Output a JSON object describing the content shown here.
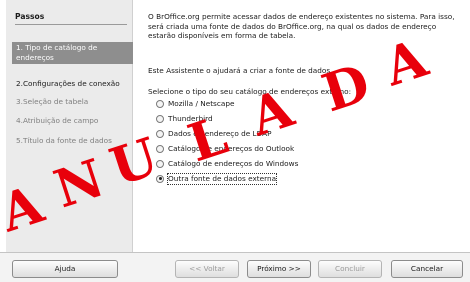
{
  "sidebar": {
    "title": "Passos",
    "steps": [
      {
        "label": "1. Tipo de catálogo de endereços",
        "active": true
      },
      {
        "label": "2.Configurações de conexão",
        "active": false
      },
      {
        "label": "3.Seleção de tabela",
        "active": false
      },
      {
        "label": "4.Atribuição de campo",
        "active": false
      },
      {
        "label": "5.Título da fonte de dados",
        "active": false
      }
    ]
  },
  "main": {
    "intro": "O BrOffice.org permite acessar dados de endereço existentes no sistema. Para isso, será criada uma fonte de dados do BrOffice.org, na qual os dados de endereço estarão disponíveis em forma de tabela.",
    "assistant": "Este Assistente o ajudará a criar a fonte de dados.",
    "select_prompt": "Selecione o tipo do seu catálogo de endereços externo:",
    "options": [
      {
        "label": "Mozilla / Netscape",
        "checked": false
      },
      {
        "label": "Thunderbird",
        "checked": false
      },
      {
        "label": "Dados de endereço de LDAP",
        "checked": false
      },
      {
        "label": "Catálogo de endereços do Outlook",
        "checked": false
      },
      {
        "label": "Catálogo de endereços do Windows",
        "checked": false
      },
      {
        "label": "Outra fonte de dados externa",
        "checked": true
      }
    ]
  },
  "buttons": {
    "help": "Ajuda",
    "back": "<< Voltar",
    "next": "Próximo >>",
    "finish": "Concluir",
    "cancel": "Cancelar"
  },
  "stamp": {
    "text": "ANULADA",
    "color": "#e8000b"
  }
}
